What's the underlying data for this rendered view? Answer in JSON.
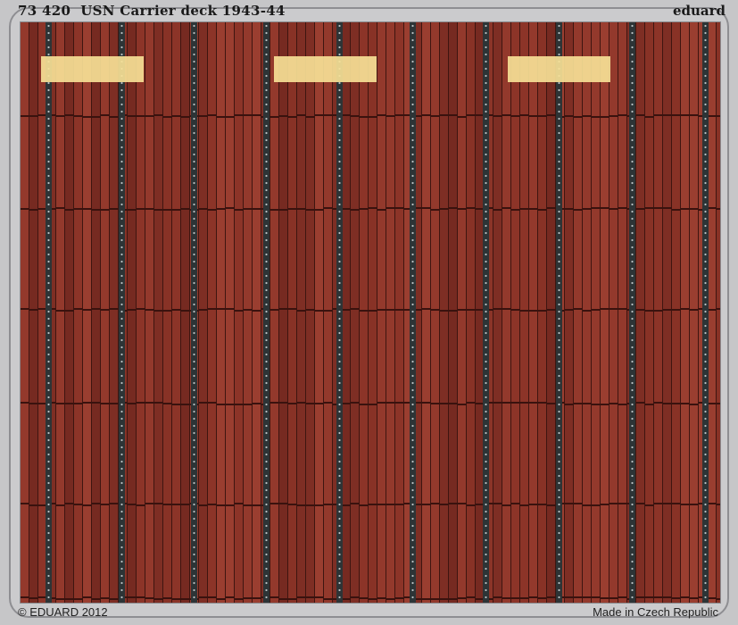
{
  "header": {
    "title": "73 420  USN Carrier deck 1943-44",
    "brand": "eduard"
  },
  "footer": {
    "copyright": "© EDUARD 2012",
    "origin": "Made in Czech Republic"
  },
  "colors": {
    "wood": "#8a3428",
    "metal": "#c6c6c8",
    "tiedown": "#2d3436",
    "highlight": "#f6e096"
  }
}
